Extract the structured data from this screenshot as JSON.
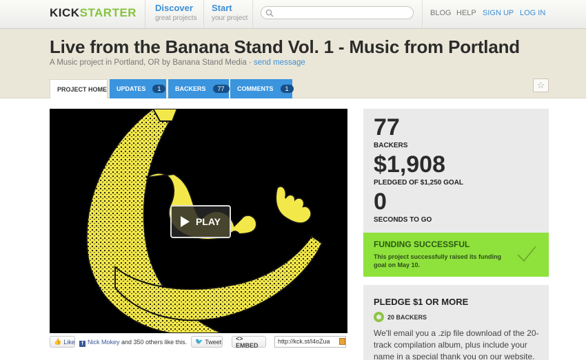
{
  "topnav": {
    "logo_part1": "KICK",
    "logo_part2": "STARTER",
    "discover_label": "Discover",
    "discover_sub": "great projects",
    "start_label": "Start",
    "start_sub": "your project",
    "search_placeholder": "",
    "blog": "BLOG",
    "help": "HELP",
    "signup": "SIGN UP",
    "login": "LOG IN"
  },
  "project": {
    "title": "Live from the Banana Stand Vol. 1 - Music from Portland",
    "subtitle": "A Music project in Portland, OR by Banana Stand Media · ",
    "send_message": "send message"
  },
  "tabs": [
    {
      "label": "PROJECT HOME"
    },
    {
      "label": "UPDATES",
      "count": "1"
    },
    {
      "label": "BACKERS",
      "count": "77"
    },
    {
      "label": "COMMENTS",
      "count": "1"
    }
  ],
  "video": {
    "play_label": "PLAY"
  },
  "share": {
    "like_label": "Like",
    "fb_name": "Nick Mokey",
    "fb_rest": " and 350 others like this.",
    "tweet_label": "Tweet",
    "embed_label": "<> EMBED",
    "short_url": "http://kck.st/l4oZua"
  },
  "stats": {
    "backers": "77",
    "backers_label": "BACKERS",
    "pledged": "$1,908",
    "pledged_label": "PLEDGED OF $1,250 GOAL",
    "seconds": "0",
    "seconds_label": "SECONDS TO GO"
  },
  "funding": {
    "title": "FUNDING SUCCESSFUL",
    "text": "This project successfully raised its funding goal on May 10."
  },
  "reward": {
    "title": "PLEDGE $1 OR MORE",
    "backers": "20 BACKERS",
    "description": "We'll email you a .zip file download of the 20-track compilation album, plus include your name in a special thank you on our website."
  },
  "colors": {
    "accent_blue": "#3a94de",
    "funded_green": "#8fe13c",
    "logo_green": "#86c440",
    "banana_yellow": "#f3e84a"
  }
}
